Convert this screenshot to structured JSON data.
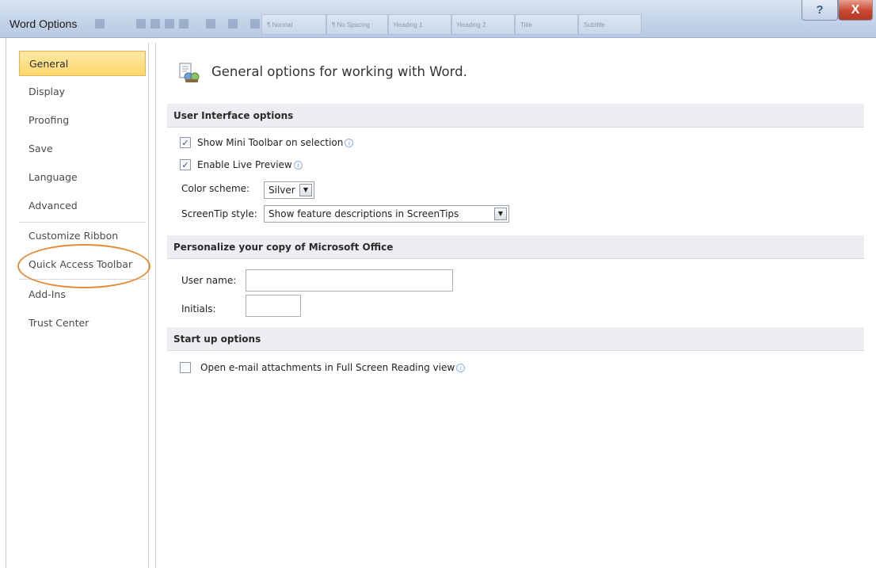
{
  "window": {
    "title": "Word Options",
    "help_glyph": "?",
    "close_glyph": "X"
  },
  "ribbon_styles": [
    "¶ Normal",
    "¶ No Spacing",
    "Heading 1",
    "Heading 2",
    "Title",
    "Subtitle"
  ],
  "sidebar": {
    "items": [
      {
        "label": "General",
        "active": true
      },
      {
        "label": "Display"
      },
      {
        "label": "Proofing"
      },
      {
        "label": "Save"
      },
      {
        "label": "Language"
      },
      {
        "label": "Advanced"
      },
      {
        "label": "Customize Ribbon"
      },
      {
        "label": "Quick Access Toolbar"
      },
      {
        "label": "Add-Ins"
      },
      {
        "label": "Trust Center"
      }
    ]
  },
  "main": {
    "header": "General options for working with Word.",
    "sections": {
      "ui": {
        "title": "User Interface options",
        "mini_toolbar": {
          "label": "Show Mini Toolbar on selection",
          "checked": true
        },
        "live_preview": {
          "label": "Enable Live Preview",
          "checked": true
        },
        "color_scheme": {
          "label": "Color scheme:",
          "value": "Silver"
        },
        "screentip": {
          "label": "ScreenTip style:",
          "value": "Show feature descriptions in ScreenTips"
        }
      },
      "personalize": {
        "title": "Personalize your copy of Microsoft Office",
        "user_name": {
          "label": "User name:",
          "value": ""
        },
        "initials": {
          "label": "Initials:",
          "value": ""
        }
      },
      "startup": {
        "title": "Start up options",
        "open_fullscreen": {
          "label": "Open e-mail attachments in Full Screen Reading view",
          "checked": false
        }
      }
    }
  },
  "colors": {
    "active_nav": "#ffd86a",
    "highlight_ring": "#e58a37",
    "close_button": "#c8472f"
  }
}
